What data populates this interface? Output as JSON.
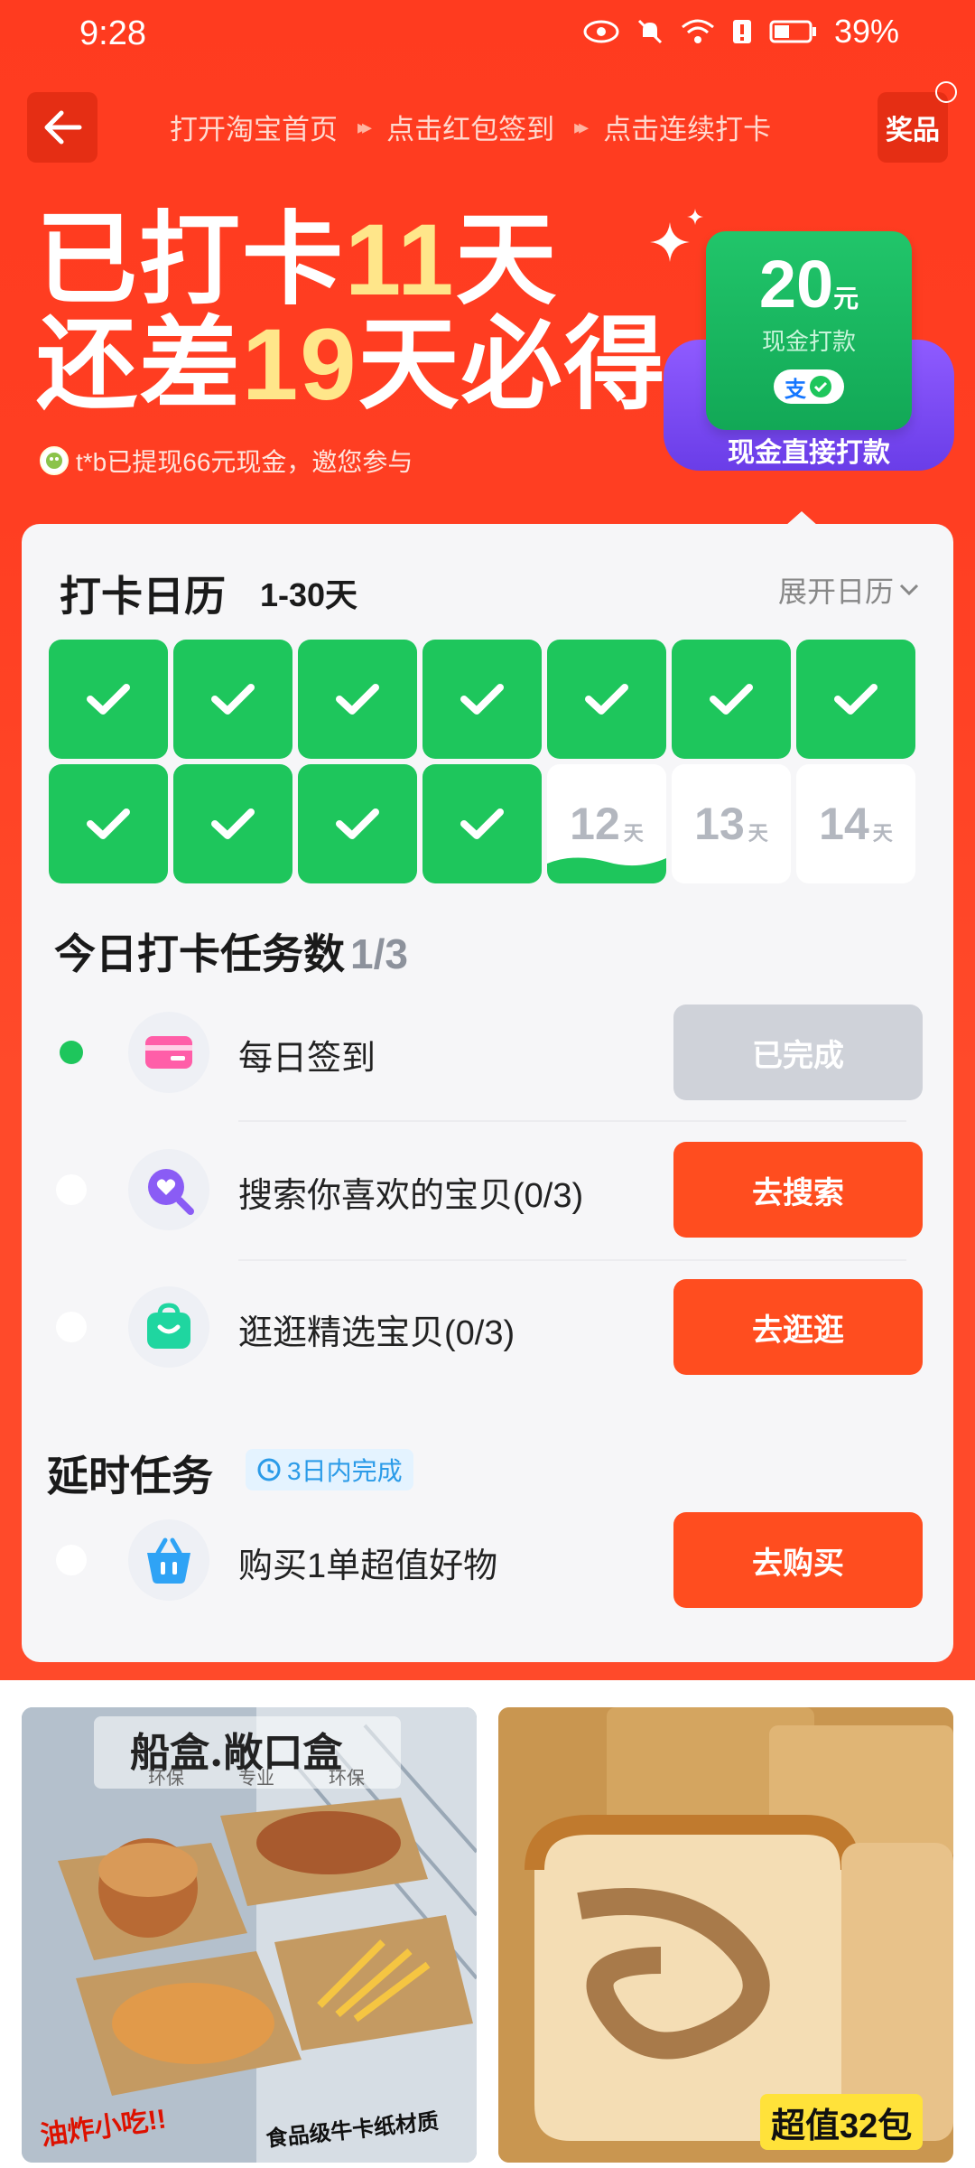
{
  "status_bar": {
    "time": "9:28",
    "battery": "39%"
  },
  "nav": {
    "steps": [
      "打开淘宝首页",
      "点击红包签到",
      "点击连续打卡"
    ],
    "prize_label": "奖品"
  },
  "hero": {
    "line1_prefix": "已打卡",
    "line1_num": "11",
    "line1_suffix": "天",
    "line2_prefix": "还差",
    "line2_num": "19",
    "line2_suffix": "天必得",
    "subtitle": "t*b已提现66元现金，邀您参与"
  },
  "reward": {
    "amount": "20",
    "unit": "元",
    "sub": "现金打款",
    "base_label": "现金直接打款",
    "pay_glyph": "支"
  },
  "calendar": {
    "title": "打卡日历",
    "range": "1-30天",
    "expand_label": "展开日历",
    "day_unit": "天",
    "checked_days": 11,
    "visible_days": [
      {
        "state": "done"
      },
      {
        "state": "done"
      },
      {
        "state": "done"
      },
      {
        "state": "done"
      },
      {
        "state": "done"
      },
      {
        "state": "done"
      },
      {
        "state": "done"
      },
      {
        "state": "done"
      },
      {
        "state": "done"
      },
      {
        "state": "done"
      },
      {
        "state": "done"
      },
      {
        "state": "today",
        "num": "12"
      },
      {
        "state": "todo",
        "num": "13"
      },
      {
        "state": "todo",
        "num": "14"
      }
    ]
  },
  "tasks": {
    "title": "今日打卡任务数",
    "progress": "1/3",
    "items": [
      {
        "label": "每日签到",
        "button": "已完成",
        "done": true,
        "icon": "card-icon"
      },
      {
        "label": "搜索你喜欢的宝贝(0/3)",
        "button": "去搜索",
        "done": false,
        "icon": "search-heart-icon"
      },
      {
        "label": "逛逛精选宝贝(0/3)",
        "button": "去逛逛",
        "done": false,
        "icon": "shopping-bag-icon"
      }
    ]
  },
  "delayed": {
    "title": "延时任务",
    "badge": "3日内完成",
    "items": [
      {
        "label": "购买1单超值好物",
        "button": "去购买",
        "done": false,
        "icon": "basket-icon"
      }
    ]
  },
  "products": [
    {
      "banner": "船盒.敞口盒",
      "banner_sub": [
        "环保",
        "专业",
        "环保"
      ],
      "caption_left": "油炸小吃!!",
      "caption_right": "食品级牛卡纸材质"
    },
    {
      "price_tag": "超值32包"
    }
  ],
  "colors": {
    "brand_red": "#ff3b1f",
    "accent_yellow": "#ffe68a",
    "check_green": "#1ec65c",
    "button_orange": "#ff4d1f",
    "reward_purple": "#7a47f0"
  }
}
